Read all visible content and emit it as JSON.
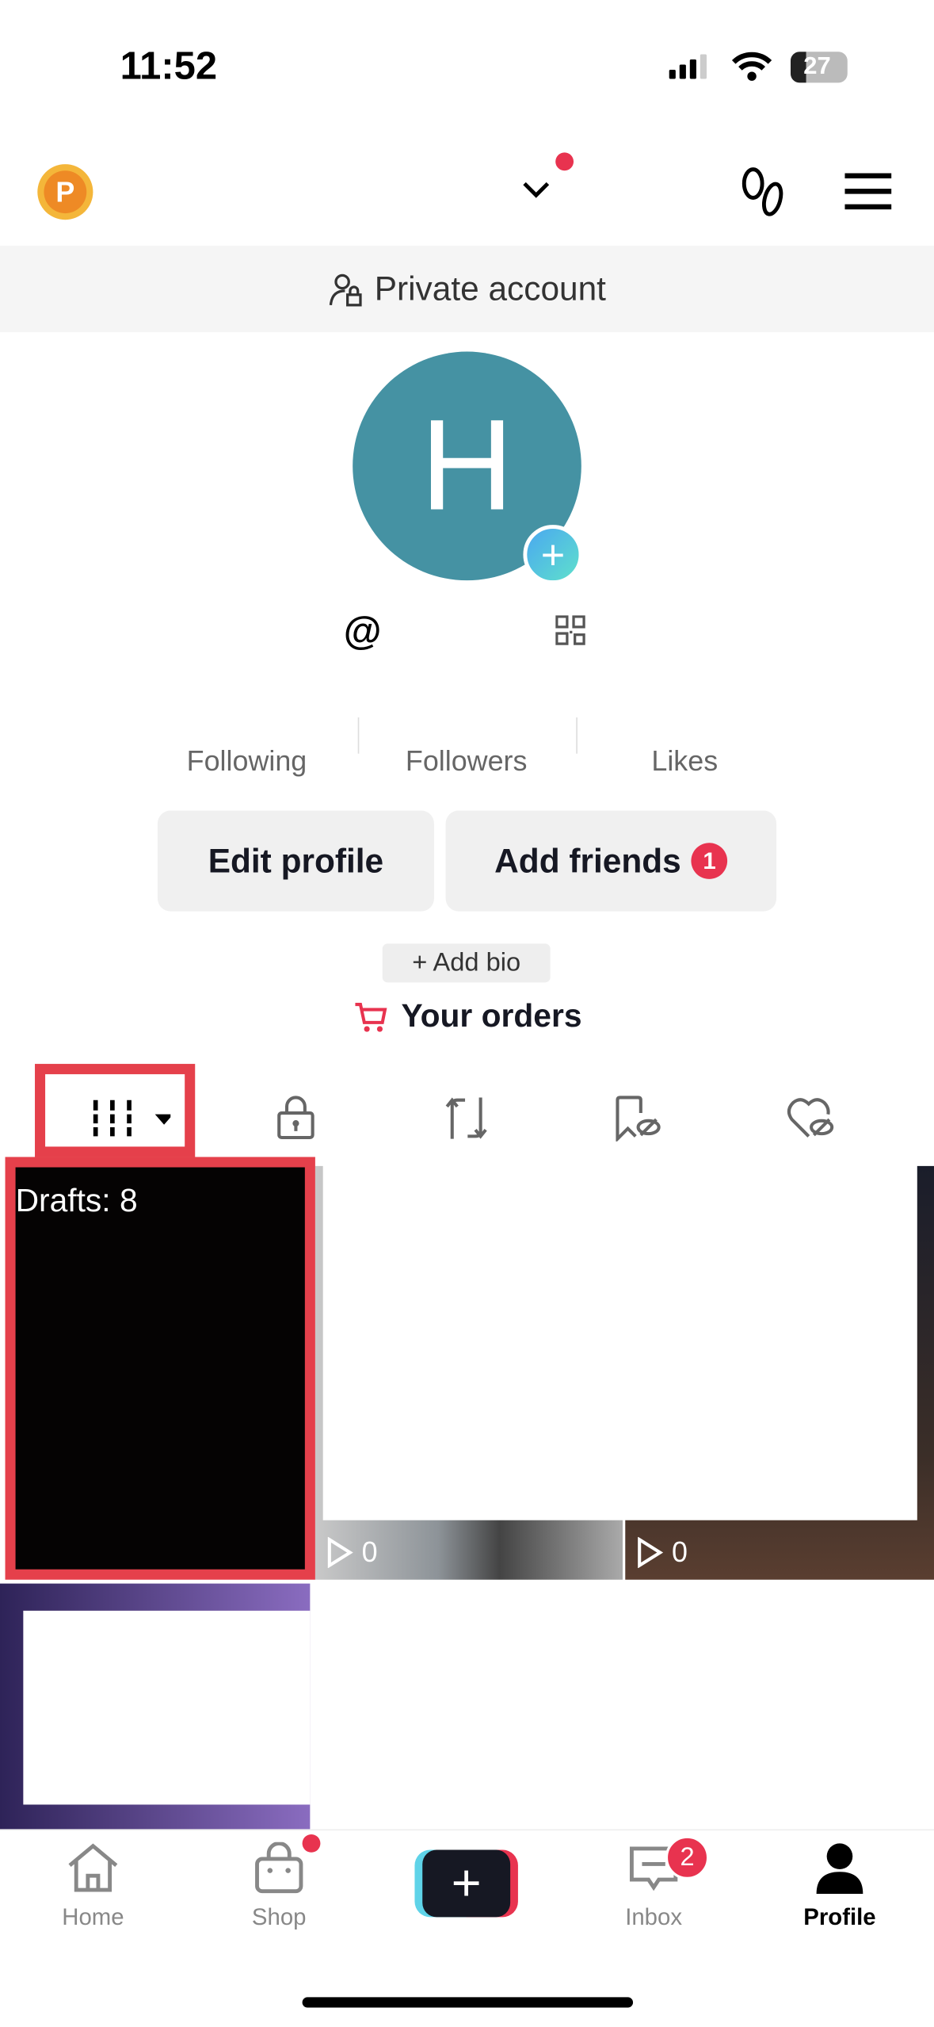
{
  "status_bar": {
    "time": "11:52",
    "battery": "27"
  },
  "header": {
    "coin_letter": "P",
    "has_notification_dot": true
  },
  "banner": {
    "text": "Private account"
  },
  "profile": {
    "avatar_letter": "H",
    "avatar_color": "#4592a3",
    "handle_prefix": "@"
  },
  "stats": [
    {
      "label": "Following"
    },
    {
      "label": "Followers"
    },
    {
      "label": "Likes"
    }
  ],
  "buttons": {
    "edit_profile": "Edit profile",
    "add_friends": "Add friends",
    "add_friends_badge": "1"
  },
  "bio": {
    "label": "+ Add bio"
  },
  "orders": {
    "label": "Your orders"
  },
  "tabs": [
    {
      "icon": "grid-icon"
    },
    {
      "icon": "lock-icon"
    },
    {
      "icon": "repost-icon"
    },
    {
      "icon": "bookmark-hidden-icon"
    },
    {
      "icon": "heart-hidden-icon"
    }
  ],
  "grid": {
    "drafts_label": "Drafts: 8",
    "videos": [
      {
        "views": "0"
      },
      {
        "views": "0"
      }
    ]
  },
  "bottom_nav": {
    "items": [
      {
        "label": "Home"
      },
      {
        "label": "Shop"
      },
      {
        "label": ""
      },
      {
        "label": "Inbox",
        "badge": "2"
      },
      {
        "label": "Profile"
      }
    ]
  },
  "colors": {
    "accent": "#e5404b",
    "badge": "#e8334f"
  }
}
